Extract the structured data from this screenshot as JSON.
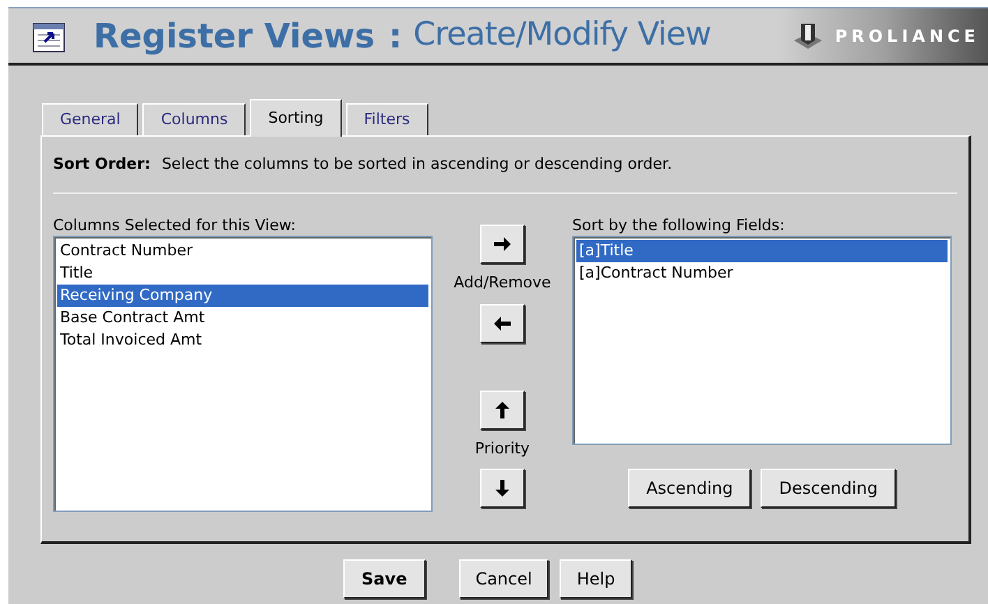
{
  "header": {
    "title": "Register Views",
    "separator": ":",
    "subtitle": "Create/Modify View",
    "logo": "PROLIANCE"
  },
  "tabs": [
    {
      "label": "General",
      "selected": false
    },
    {
      "label": "Columns",
      "selected": false
    },
    {
      "label": "Sorting",
      "selected": true
    },
    {
      "label": "Filters",
      "selected": false
    }
  ],
  "instruction": {
    "label": "Sort Order:",
    "text": "Select the columns to be sorted in ascending or descending order."
  },
  "available": {
    "label": "Columns Selected for this View:",
    "items": [
      {
        "text": "Contract Number",
        "selected": false
      },
      {
        "text": "Title",
        "selected": false
      },
      {
        "text": "Receiving Company",
        "selected": true
      },
      {
        "text": "Base Contract Amt",
        "selected": false
      },
      {
        "text": "Total Invoiced Amt",
        "selected": false
      }
    ]
  },
  "add_remove_label": "Add/Remove",
  "priority_label": "Priority",
  "sort_fields": {
    "label": "Sort by the following Fields:",
    "items": [
      {
        "text": "[a]Title",
        "selected": true
      },
      {
        "text": "[a]Contract Number",
        "selected": false
      }
    ]
  },
  "sort_buttons": [
    "Ascending",
    "Descending"
  ],
  "footer_buttons": [
    {
      "label": "Save",
      "primary": true
    },
    {
      "label": "Cancel",
      "primary": false
    },
    {
      "label": "Help",
      "primary": false
    }
  ]
}
